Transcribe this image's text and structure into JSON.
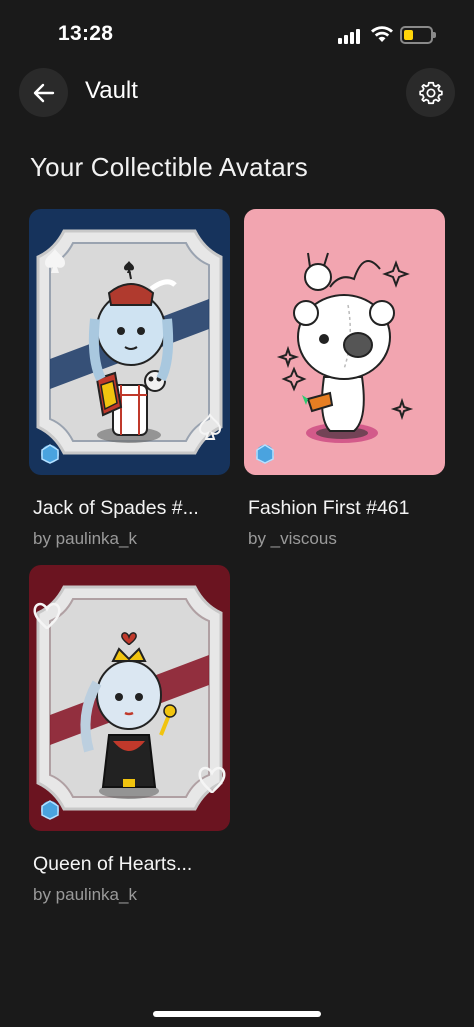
{
  "status_bar": {
    "time": "13:28"
  },
  "header": {
    "title": "Vault"
  },
  "section": {
    "title": "Your Collectible Avatars"
  },
  "avatars": [
    {
      "name": "Jack of Spades #...",
      "creator": "by paulinka_k",
      "suit": "spade-icon",
      "background": "#16335c"
    },
    {
      "name": "Fashion First #461",
      "creator": "by _viscous",
      "suit": "",
      "background": "#f2a5b0"
    },
    {
      "name": "Queen of Hearts...",
      "creator": "by paulinka_k",
      "suit": "heart-icon",
      "background": "#6b1420"
    }
  ],
  "colors": {
    "background": "#1a1a1a",
    "battery": "#ffd60a",
    "spades_card": "#16335c",
    "fashion_card": "#f2a5b0",
    "hearts_card": "#6b1420"
  }
}
